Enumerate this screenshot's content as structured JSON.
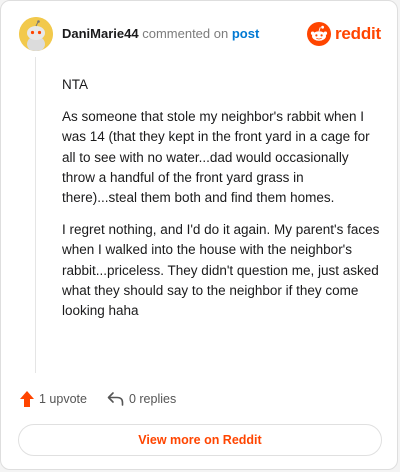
{
  "comment": {
    "author": "DaniMarie44",
    "action_text": "commented on",
    "post_link_label": "post",
    "paragraphs": [
      "NTA",
      "As someone that stole my neighbor's rabbit when I was 14 (that they kept in the front yard in a cage for all to see with no water...dad would occasionally throw a handful of the front yard grass in there)...steal them both and find them homes.",
      "I regret nothing, and I'd do it again. My parent's faces when I walked into the house with the neighbor's rabbit...priceless. They didn't question me, just asked what they should say to the neighbor if they come looking haha"
    ]
  },
  "brand": {
    "logo_text": "reddit",
    "color": "#ff4500"
  },
  "footer": {
    "upvote_label": "1 upvote",
    "replies_label": "0 replies",
    "view_more_label": "View more on Reddit"
  },
  "icons": {
    "avatar": "avatar-icon",
    "logo": "reddit-logo-icon",
    "upvote": "upvote-arrow-icon",
    "reply": "reply-arrow-icon"
  }
}
